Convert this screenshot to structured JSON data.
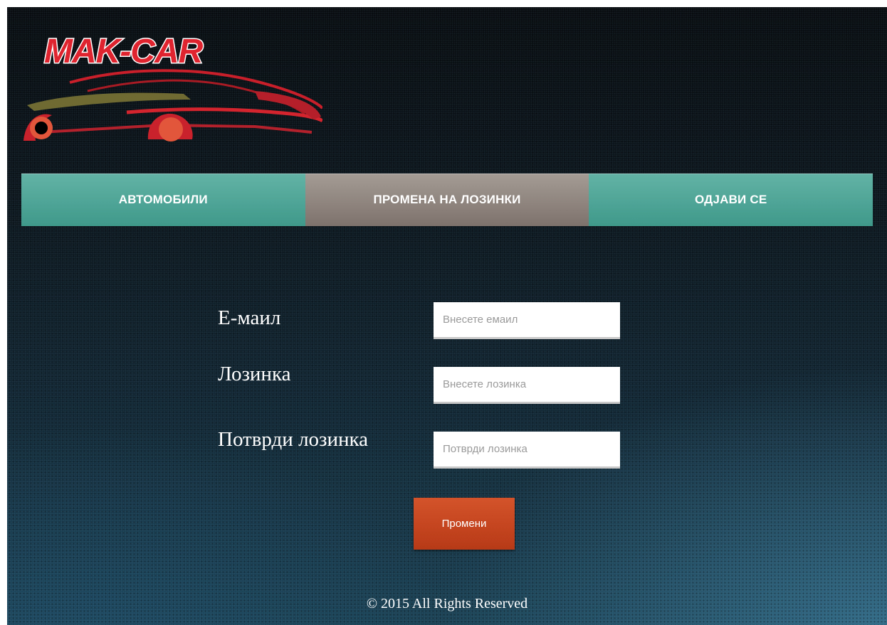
{
  "brand": {
    "logo_text": "MAK-CAR"
  },
  "nav": {
    "items": [
      {
        "label": "АВТОМОБИЛИ"
      },
      {
        "label": "ПРОМЕНА НА ЛОЗИНКИ"
      },
      {
        "label": "ОДЈАВИ СЕ"
      }
    ],
    "active_index": 1
  },
  "form": {
    "email": {
      "label": "Е-маил",
      "placeholder": "Внесете емаил",
      "value": ""
    },
    "password": {
      "label": "Лозинка",
      "placeholder": "Внесете лозинка",
      "value": ""
    },
    "confirm": {
      "label": "Потврди лозинка",
      "placeholder": "Потврди лозинка",
      "value": ""
    },
    "submit_label": "Промени"
  },
  "footer": {
    "text": "© 2015 All Rights Reserved"
  },
  "colors": {
    "nav_teal": "#4fa699",
    "nav_active": "#8f847e",
    "button_orange": "#c4461f",
    "logo_red": "#e0242f"
  }
}
